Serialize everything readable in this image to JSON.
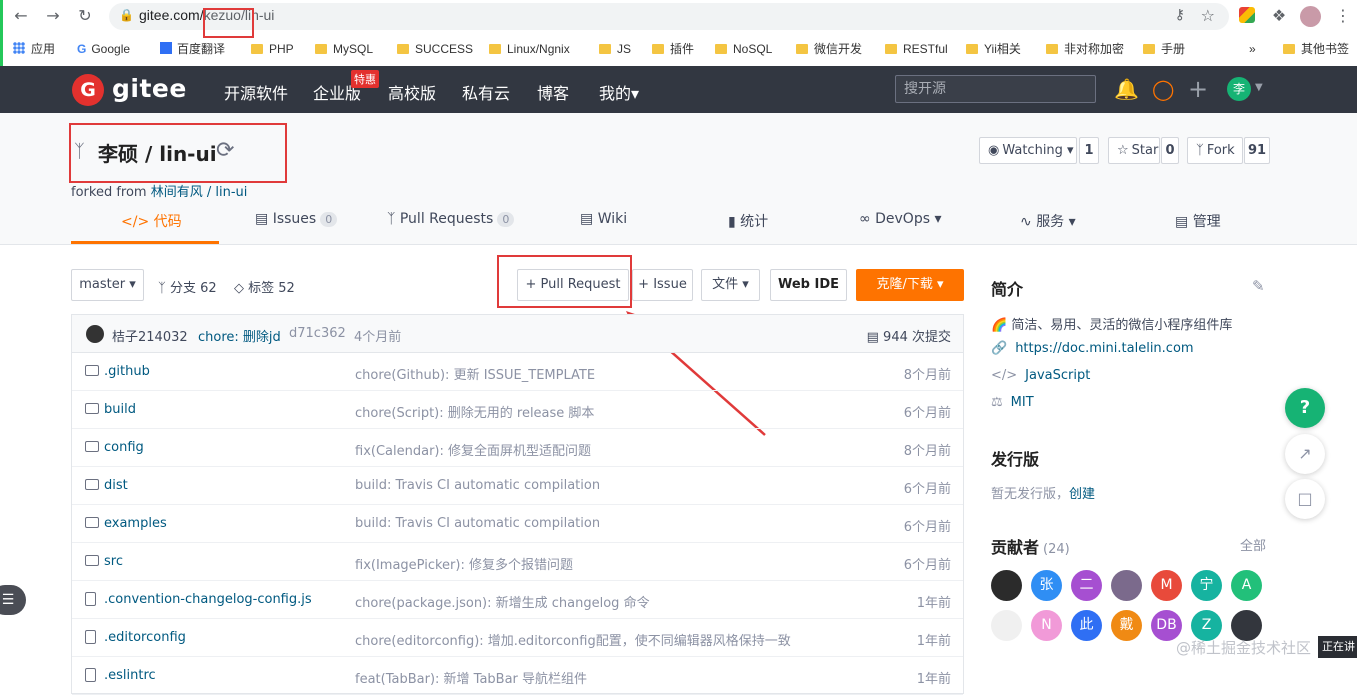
{
  "browser": {
    "url_host": "gitee.com/",
    "url_path": "kezuo/lin-ui",
    "bookmarks": [
      "应用",
      "Google",
      "百度翻译",
      "PHP",
      "MySQL",
      "SUCCESS",
      "Linux/Ngnix",
      "JS",
      "插件",
      "NoSQL",
      "微信开发",
      "RESTful",
      "Yii相关",
      "非对称加密",
      "手册",
      "»",
      "其他书签"
    ]
  },
  "gitee": {
    "logo_text": "gitee",
    "logo_letter": "G",
    "nav": [
      "开源软件",
      "企业版",
      "高校版",
      "私有云",
      "博客",
      "我的▾"
    ],
    "tehui_badge": "特惠",
    "search_placeholder": "搜开源",
    "user_avatar": "李"
  },
  "repo": {
    "title": "李硕 / lin-ui",
    "forked_prefix": "forked from ",
    "forked_link": "林间有风 / lin-ui",
    "watching_label": "Watching ▾",
    "watching_count": "1",
    "star_label": "Star",
    "star_count": "0",
    "fork_label": "Fork",
    "fork_count": "91",
    "tabs": [
      {
        "label": "</> 代码"
      },
      {
        "label": "Issues",
        "badge": "0"
      },
      {
        "label": "Pull Requests",
        "badge": "0"
      },
      {
        "label": "Wiki"
      },
      {
        "label": "统计"
      },
      {
        "label": "DevOps ▾"
      },
      {
        "label": "服务 ▾"
      },
      {
        "label": "管理"
      }
    ]
  },
  "toolbar": {
    "branch": "master ▾",
    "branches": "分支 62",
    "tags": "标签 52",
    "pull_request": "+ Pull Request",
    "issue": "+ Issue",
    "file": "文件 ▾",
    "web_ide": "Web IDE",
    "clone": "克隆/下载 ▾"
  },
  "commit": {
    "author": "桔子214032",
    "message": "chore: 删除jd",
    "hash": "d71c362",
    "time": "4个月前",
    "count": "944 次提交"
  },
  "files": [
    {
      "name": ".github",
      "type": "dir",
      "msg": "chore(Github): 更新 ISSUE_TEMPLATE",
      "time": "8个月前"
    },
    {
      "name": "build",
      "type": "dir",
      "msg": "chore(Script): 删除无用的 release 脚本",
      "time": "6个月前"
    },
    {
      "name": "config",
      "type": "dir",
      "msg": "fix(Calendar): 修复全面屏机型适配问题",
      "time": "8个月前"
    },
    {
      "name": "dist",
      "type": "dir",
      "msg": "build: Travis CI automatic compilation",
      "time": "6个月前"
    },
    {
      "name": "examples",
      "type": "dir",
      "msg": "build: Travis CI automatic compilation",
      "time": "6个月前"
    },
    {
      "name": "src",
      "type": "dir",
      "msg": "fix(ImagePicker): 修复多个报错问题",
      "time": "6个月前"
    },
    {
      "name": ".convention-changelog-config.js",
      "type": "file",
      "msg": "chore(package.json): 新增生成 changelog 命令",
      "time": "1年前"
    },
    {
      "name": ".editorconfig",
      "type": "file",
      "msg": "chore(editorconfig): 增加.editorconfig配置，使不同编辑器风格保持一致",
      "time": "1年前"
    },
    {
      "name": ".eslintrc",
      "type": "file",
      "msg": "feat(TabBar): 新增 TabBar 导航栏组件",
      "time": "1年前"
    }
  ],
  "sidebar": {
    "intro_title": "简介",
    "intro_desc": "🌈 简洁、易用、灵活的微信小程序组件库",
    "homepage": "https://doc.mini.talelin.com",
    "language": "JavaScript",
    "license": "MIT",
    "release_title": "发行版",
    "release_text": "暂无发行版，",
    "release_link": "创建",
    "contrib_title": "贡献者",
    "contrib_count": "(24)",
    "contrib_all": "全部",
    "contributors": [
      {
        "t": "",
        "c": "#2b2b2b"
      },
      {
        "t": "张",
        "c": "#2f8ef4"
      },
      {
        "t": "二",
        "c": "#a64fd1"
      },
      {
        "t": "",
        "c": "#7b6a8c"
      },
      {
        "t": "M",
        "c": "#e84a3b"
      },
      {
        "t": "宁",
        "c": "#16b3a0"
      },
      {
        "t": "A",
        "c": "#22c07a"
      },
      {
        "t": "",
        "c": "#f0f0f0"
      },
      {
        "t": "N",
        "c": "#f19ad8"
      },
      {
        "t": "此",
        "c": "#2f6ff4"
      },
      {
        "t": "戴",
        "c": "#f08a14"
      },
      {
        "t": "DB",
        "c": "#a64fd1"
      },
      {
        "t": "Z",
        "c": "#16b3a0"
      },
      {
        "t": "",
        "c": "#33363d"
      }
    ]
  },
  "watermark": "@稀土掘金技术社区",
  "side_tag": "正在讲",
  "float_help": "?"
}
